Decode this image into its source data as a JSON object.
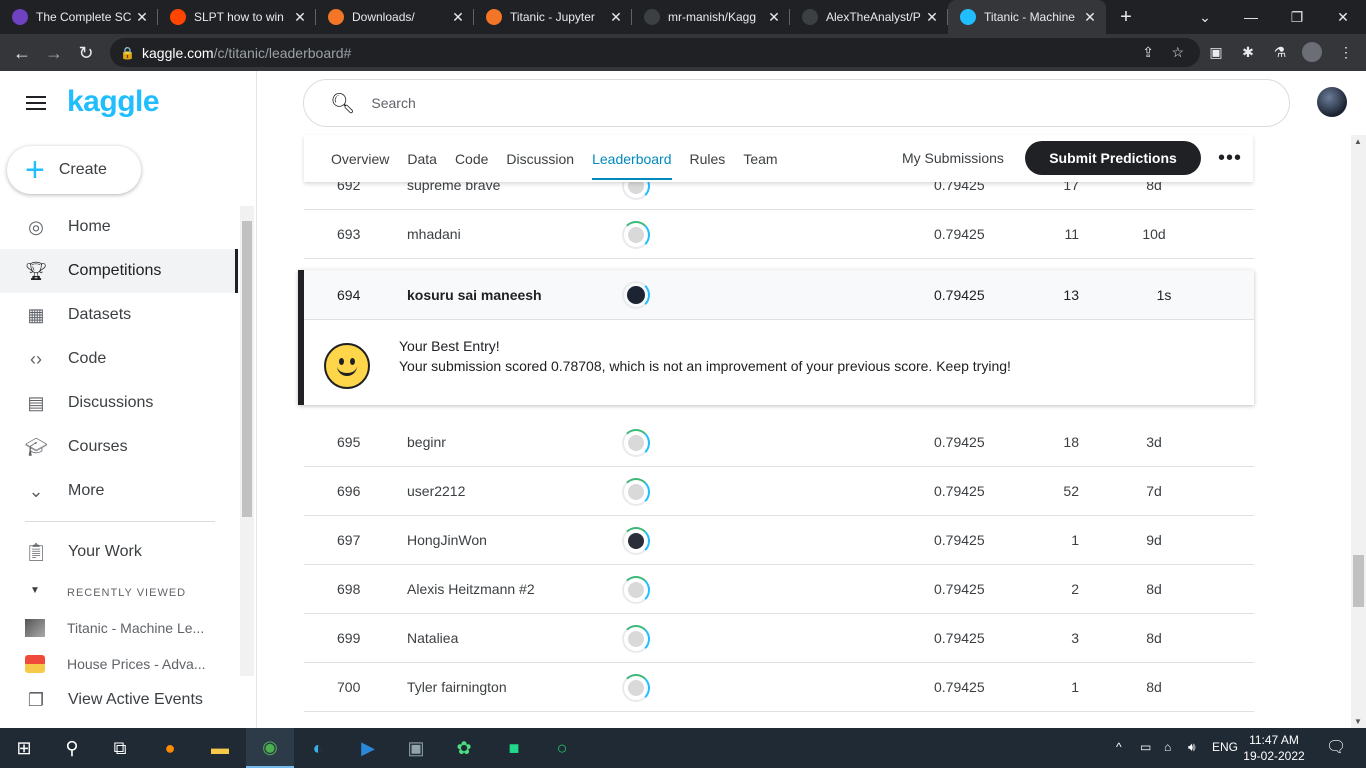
{
  "browser": {
    "tabs": [
      {
        "title": "The Complete SC",
        "fav_color": "#6f42c1"
      },
      {
        "title": "SLPT how to win",
        "fav_color": "#ff4500"
      },
      {
        "title": "Downloads/",
        "fav_color": "#f37626"
      },
      {
        "title": "Titanic - Jupyter",
        "fav_color": "#f37626"
      },
      {
        "title": "mr-manish/Kagg",
        "fav_color": "#3c4043"
      },
      {
        "title": "AlexTheAnalyst/P",
        "fav_color": "#3c4043"
      },
      {
        "title": "Titanic - Machine",
        "fav_color": "#20beff"
      }
    ],
    "url_host": "kaggle.com",
    "url_path": "/c/titanic/leaderboard#"
  },
  "sidebar": {
    "logo": "kaggle",
    "create_label": "Create",
    "items": [
      {
        "label": "Home",
        "icon": "compass-icon"
      },
      {
        "label": "Competitions",
        "icon": "trophy-icon"
      },
      {
        "label": "Datasets",
        "icon": "table-icon"
      },
      {
        "label": "Code",
        "icon": "code-icon"
      },
      {
        "label": "Discussions",
        "icon": "comment-icon"
      },
      {
        "label": "Courses",
        "icon": "school-icon"
      },
      {
        "label": "More",
        "icon": "chevron-down-icon"
      }
    ],
    "your_work": "Your Work",
    "recently_viewed": "RECENTLY VIEWED",
    "recent": [
      {
        "label": "Titanic - Machine Le..."
      },
      {
        "label": "House Prices - Adva..."
      }
    ],
    "view_active_events": "View Active Events"
  },
  "search": {
    "placeholder": "Search"
  },
  "comp_nav": {
    "tabs": [
      "Overview",
      "Data",
      "Code",
      "Discussion",
      "Leaderboard",
      "Rules",
      "Team"
    ],
    "active": "Leaderboard",
    "my_submissions": "My Submissions",
    "submit": "Submit Predictions"
  },
  "leaderboard": {
    "rows_above": [
      {
        "rank": "692",
        "name": "supreme brave",
        "score": "0.79425",
        "entries": "17",
        "last": "8d",
        "dark": false
      },
      {
        "rank": "693",
        "name": "mhadani",
        "score": "0.79425",
        "entries": "11",
        "last": "10d",
        "dark": false
      }
    ],
    "highlight": {
      "rank": "694",
      "name": "kosuru sai maneesh",
      "score": "0.79425",
      "entries": "13",
      "last": "1s",
      "msg_title": "Your Best Entry!",
      "msg_body": "Your submission scored 0.78708, which is not an improvement of your previous score. Keep trying!"
    },
    "rows_below": [
      {
        "rank": "695",
        "name": "beginr",
        "score": "0.79425",
        "entries": "18",
        "last": "3d",
        "dark": false
      },
      {
        "rank": "696",
        "name": "user2212",
        "score": "0.79425",
        "entries": "52",
        "last": "7d",
        "dark": false
      },
      {
        "rank": "697",
        "name": "HongJinWon",
        "score": "0.79425",
        "entries": "1",
        "last": "9d",
        "dark": true
      },
      {
        "rank": "698",
        "name": "Alexis Heitzmann #2",
        "score": "0.79425",
        "entries": "2",
        "last": "8d",
        "dark": false
      },
      {
        "rank": "699",
        "name": "Nataliea",
        "score": "0.79425",
        "entries": "3",
        "last": "8d",
        "dark": false
      },
      {
        "rank": "700",
        "name": "Tyler fairnington",
        "score": "0.79425",
        "entries": "1",
        "last": "8d",
        "dark": false
      }
    ]
  },
  "taskbar": {
    "lang": "ENG",
    "time": "11:47 AM",
    "date": "19-02-2022"
  }
}
